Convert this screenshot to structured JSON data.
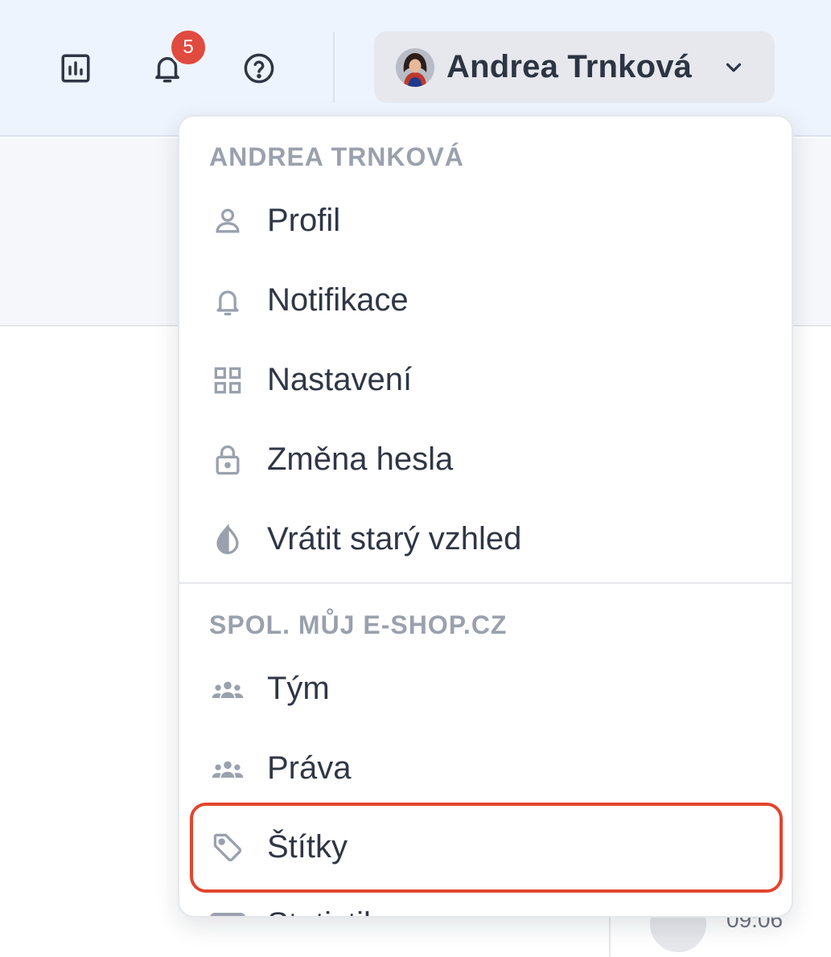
{
  "topbar": {
    "icons": [
      "chart-icon",
      "bell-icon",
      "help-icon"
    ],
    "notification_count": "5",
    "user": {
      "name": "Andrea Trnková",
      "avatar_icon": "user-avatar",
      "chevron_icon": "chevron-down-icon"
    }
  },
  "dropdown": {
    "sections": [
      {
        "header": "ANDREA TRNKOVÁ",
        "items": [
          {
            "label": "Profil",
            "icon": "user-icon"
          },
          {
            "label": "Notifikace",
            "icon": "bell-icon"
          },
          {
            "label": "Nastavení",
            "icon": "grid-icon"
          },
          {
            "label": "Změna hesla",
            "icon": "lock-icon"
          },
          {
            "label": "Vrátit starý vzhled",
            "icon": "contrast-icon"
          }
        ]
      },
      {
        "header": "SPOL. MŮJ E-SHOP.CZ",
        "items": [
          {
            "label": "Tým",
            "icon": "team-icon"
          },
          {
            "label": "Práva",
            "icon": "team-icon"
          },
          {
            "label": "Štítky",
            "icon": "tag-icon",
            "highlighted": true
          },
          {
            "label": "Statistiky",
            "icon": "stats-icon",
            "partially_visible": true
          }
        ]
      }
    ]
  },
  "background": {
    "time": "09:06"
  },
  "colors": {
    "topbar_bg": "#eef4fd",
    "badge": "#e04a3f",
    "highlight_border": "#e2452f",
    "section_header": "#9aa1ad",
    "text": "#2f3645"
  }
}
